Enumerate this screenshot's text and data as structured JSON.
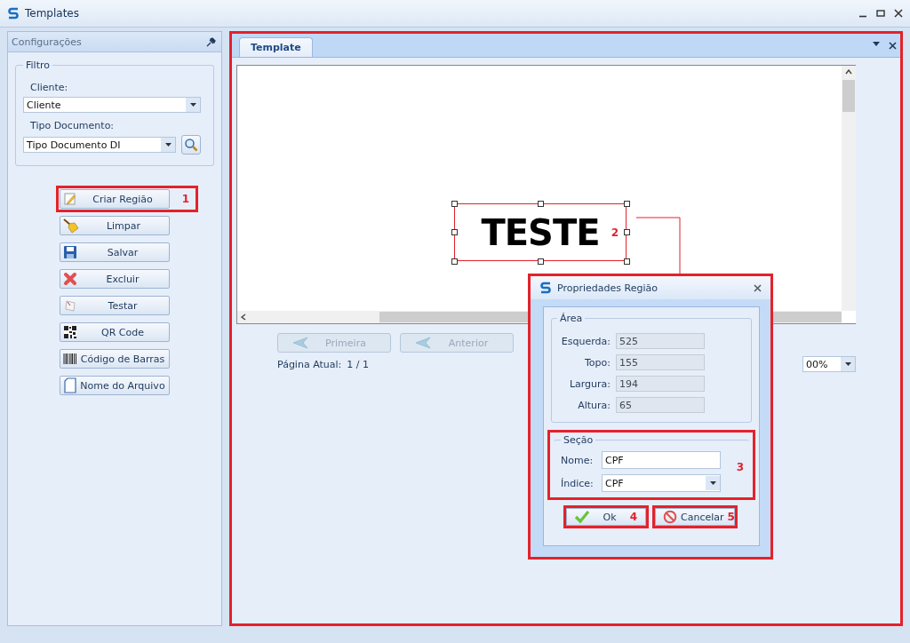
{
  "window": {
    "title": "Templates"
  },
  "left_panel": {
    "title": "Configurações",
    "filter": {
      "legend": "Filtro",
      "fields": [
        {
          "label": "Cliente:",
          "value": "Cliente"
        },
        {
          "label": "Tipo Documento:",
          "value": "Tipo Documento DI"
        }
      ]
    },
    "buttons": [
      {
        "label": "Criar Região",
        "callout": "1"
      },
      {
        "label": "Limpar"
      },
      {
        "label": "Salvar"
      },
      {
        "label": "Excluir"
      },
      {
        "label": "Testar"
      },
      {
        "label": "QR Code"
      },
      {
        "label": "Código de Barras"
      },
      {
        "label": "Nome do Arquivo"
      }
    ]
  },
  "document": {
    "tabs": [
      {
        "label": "Template",
        "selected": true
      }
    ],
    "canvas": {
      "region_text": "TESTE",
      "callout": "2"
    },
    "nav_buttons": [
      {
        "label": "Primeira",
        "disabled": true
      },
      {
        "label": "Anterior",
        "disabled": true
      }
    ],
    "page_label": "Página Atual:",
    "page_value": "1 / 1",
    "zoom": "00%"
  },
  "dialog": {
    "title": "Propriedades Região",
    "area": {
      "legend": "Área",
      "fields": [
        {
          "label": "Esquerda:",
          "value": "525"
        },
        {
          "label": "Topo:",
          "value": "155"
        },
        {
          "label": "Largura:",
          "value": "194"
        },
        {
          "label": "Altura:",
          "value": "65"
        }
      ]
    },
    "section": {
      "legend": "Seção",
      "callout": "3",
      "name": {
        "label": "Nome:",
        "value": "CPF"
      },
      "index": {
        "label": "Índice:",
        "value": "CPF"
      }
    },
    "buttons": [
      {
        "label": "Ok",
        "kind": "ok",
        "callout": "4"
      },
      {
        "label": "Cancelar",
        "kind": "cancel",
        "callout": "5"
      }
    ]
  }
}
